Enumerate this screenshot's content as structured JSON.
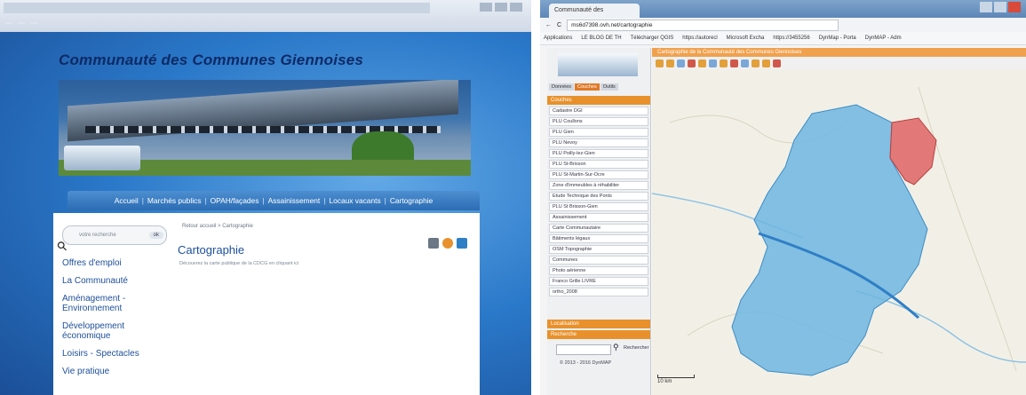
{
  "left_screenshot": {
    "site_title": "Communauté des Communes Giennoises",
    "nav_items": [
      "Accueil",
      "Marchés publics",
      "OPAH/façades",
      "Assainissement",
      "Locaux vacants",
      "Cartographie"
    ],
    "search_placeholder": "votre recherche",
    "search_button": "ok",
    "sidebar_items": [
      "Offres d'emploi",
      "La Communauté",
      "Aménagement - Environnement",
      "Développement économique",
      "Loisirs - Spectacles",
      "Vie pratique"
    ],
    "breadcrumb": "Retour accueil > Cartographie",
    "page_title": "Cartographie",
    "description": "Découvrez la carte publique de la CDCG en cliquant ici",
    "colors": {
      "title": "#0e2a66",
      "link": "#1d4f9a",
      "nav": "#2b6cb3"
    }
  },
  "right_screenshot": {
    "tab_title": "Communauté des",
    "url": "ms6d7398.ovh.net/cartographie",
    "bookmarks": [
      "Applications",
      "LE BLOG DE TH",
      "Télécharger QGIS",
      "https://autorecl",
      "Microsoft Excha",
      "https://3455256",
      "DynMap - Porta",
      "DynMAP - Adm"
    ],
    "panel_tabs": [
      "Données",
      "Couches",
      "Outils"
    ],
    "panel_header": "Couches",
    "layers": [
      "Cadastre DGI",
      "PLU Coullons",
      "PLU Gien",
      "PLU Nevoy",
      "PLU Poilly-lez-Gien",
      "PLU St-Brisson",
      "PLU St-Martin-Sur-Ocre",
      "Zone d'immeubles à réhabiliter",
      "Etude Technique des Ponts",
      "PLU St Brisson-Gien",
      "Assainissement",
      "Carte Communautaire",
      "Bâtiments légaux",
      "OSM Topographie",
      "Communes",
      "Photo aérienne",
      "Franco Grille LIVRE",
      "ortho_2008"
    ],
    "bottom_sections": [
      "Localisation",
      "Recherche"
    ],
    "search_label": "Rechercher",
    "copyright": "© 2013 - 2016 DynMAP",
    "map_title": "Cartographie de la Communauté des Communes Giennoises",
    "scale_label": "10 km",
    "colors": {
      "orange": "#e8912c",
      "territory_fill": "#6fb6e0",
      "selected_commune": "#e06a6a",
      "river": "#2f7fc6"
    }
  }
}
